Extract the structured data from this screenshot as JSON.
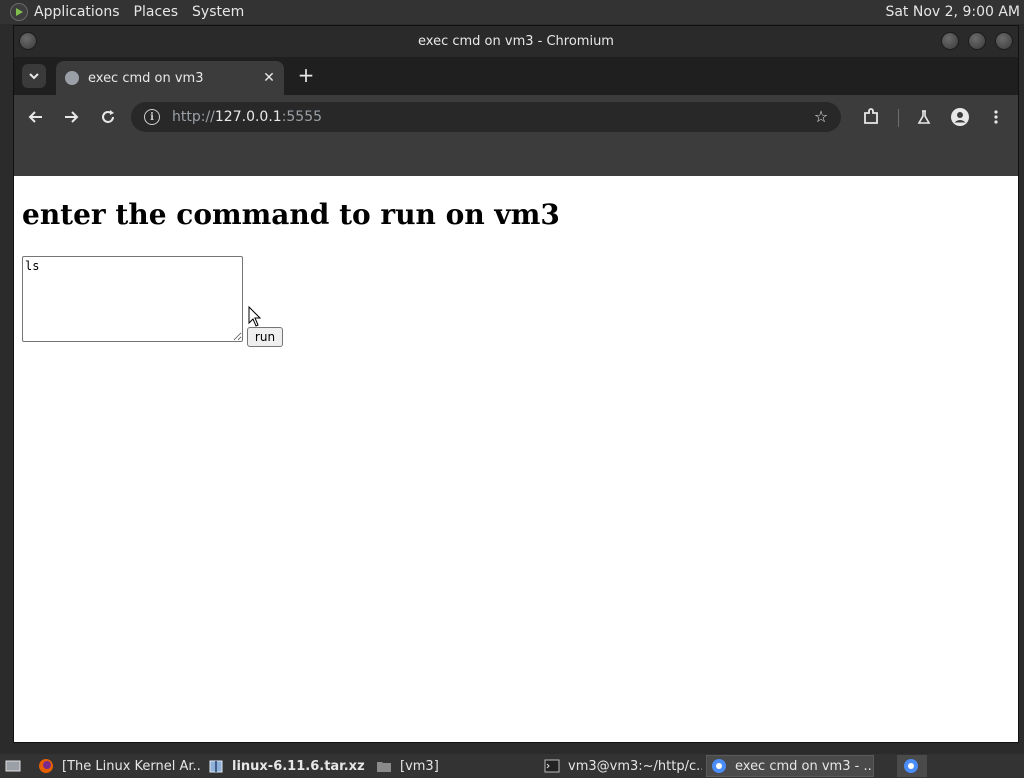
{
  "top_panel": {
    "menus": [
      "Applications",
      "Places",
      "System"
    ],
    "clock": "Sat Nov  2,  9:00 AM"
  },
  "window": {
    "title": "exec cmd on vm3 - Chromium"
  },
  "tabs": {
    "active_title": "exec cmd on vm3",
    "close_glyph": "✕",
    "new_tab_glyph": "+"
  },
  "toolbar": {
    "url_scheme": "http://",
    "url_host": "127.0.0.1",
    "url_rest": ":5555"
  },
  "page": {
    "heading": "enter the command to run on vm3",
    "command_value": "ls",
    "run_label": "run"
  },
  "taskbar": {
    "items": [
      {
        "label": "[The Linux Kernel Ar...",
        "icon": "firefox-icon"
      },
      {
        "label": "linux-6.11.6.tar.xz",
        "icon": "archive-icon"
      },
      {
        "label": "[vm3]",
        "icon": "folder-icon"
      },
      {
        "label": "vm3@vm3:~/http/c...",
        "icon": "terminal-icon"
      },
      {
        "label": "exec cmd on vm3 - ...",
        "icon": "chromium-icon"
      }
    ]
  },
  "colors": {
    "panel_bg": "#333333",
    "chrome_toolbar": "#3c3c3c",
    "page_bg": "#ffffff"
  }
}
